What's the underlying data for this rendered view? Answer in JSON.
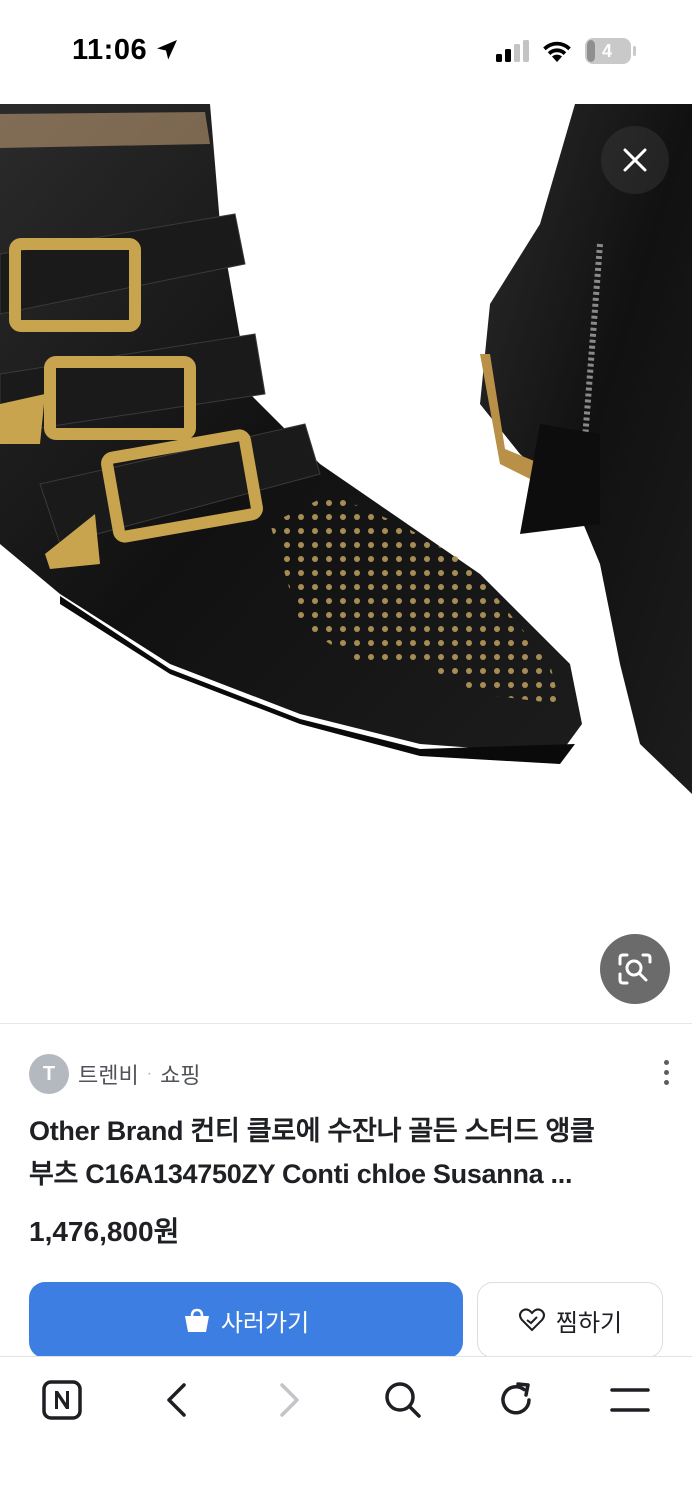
{
  "status_bar": {
    "time": "11:06",
    "battery_level": "4",
    "icons": [
      "location-arrow-icon",
      "cellular-signal-icon",
      "wifi-icon",
      "battery-icon"
    ]
  },
  "product_image": {
    "alt": "Black leather ankle boots with gold studs and buckles",
    "buttons": [
      "close-icon",
      "lens-search-icon"
    ]
  },
  "seller": {
    "avatar_letter": "T",
    "name": "트렌비",
    "separator": "·",
    "category": "쇼핑"
  },
  "product": {
    "title_line1": "Other Brand 컨티 클로에 수잔나 골든 스터드 앵클",
    "title_line2": "부츠 C16A134750ZY Conti chloe Susanna ...",
    "price": "1,476,800원"
  },
  "actions": {
    "buy_label": "사러가기",
    "wish_label": "찜하기"
  },
  "colors": {
    "primary": "#3d7ee3",
    "text": "#1f2024",
    "muted": "#505358"
  },
  "toolbar": {
    "items": [
      "naver-home-icon",
      "back-chevron-icon",
      "forward-chevron-icon",
      "search-icon",
      "reload-icon",
      "menu-icon"
    ]
  }
}
